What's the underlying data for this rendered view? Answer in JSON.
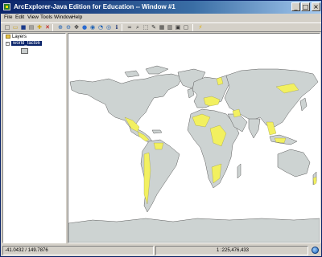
{
  "window": {
    "title": "ArcExplorer-Java Edition for Education -- Window #1",
    "controls": {
      "minimize": "_",
      "maximize": "□",
      "close": "×"
    }
  },
  "menu": [
    "File",
    "Edit",
    "View",
    "Tools",
    "Window",
    "Help"
  ],
  "toolbar": {
    "buttons": [
      {
        "icon": "new-project-icon",
        "glyph": "□"
      },
      {
        "icon": "open-folder-icon",
        "glyph": "▭"
      },
      {
        "icon": "save-icon",
        "glyph": "■"
      },
      {
        "icon": "print-icon",
        "glyph": "▤"
      },
      {
        "icon": "add-layer-icon",
        "glyph": "✚"
      },
      {
        "icon": "remove-layer-icon",
        "glyph": "✕"
      },
      {
        "icon": "zoom-in-icon",
        "glyph": "⊕"
      },
      {
        "icon": "zoom-out-icon",
        "glyph": "⊖"
      },
      {
        "icon": "pan-icon",
        "glyph": "✥"
      },
      {
        "icon": "full-extent-globe-icon",
        "glyph": "●"
      },
      {
        "icon": "zoom-to-layer-icon",
        "glyph": "◉"
      },
      {
        "icon": "zoom-previous-icon",
        "glyph": "◔"
      },
      {
        "icon": "zoom-selected-icon",
        "glyph": "◎"
      },
      {
        "icon": "identify-icon",
        "glyph": "ℹ"
      },
      {
        "icon": "find-binoculars-icon",
        "glyph": "∞"
      },
      {
        "icon": "query-icon",
        "glyph": "⌕"
      },
      {
        "icon": "select-icon",
        "glyph": "⬚"
      },
      {
        "icon": "measure-icon",
        "glyph": "✎"
      },
      {
        "icon": "attribute-table-icon",
        "glyph": "▦"
      },
      {
        "icon": "chart-icon",
        "glyph": "▥"
      },
      {
        "icon": "map-properties-icon",
        "glyph": "▣"
      },
      {
        "icon": "layout-icon",
        "glyph": "▢"
      },
      {
        "icon": "hotlink-lightning-icon",
        "glyph": "⚡"
      }
    ]
  },
  "toc": {
    "root_label": "Layers",
    "layer_label": "world_facts6",
    "expander": "−",
    "swatch_color": "#c8cdcd"
  },
  "map": {
    "land_color": "#cdd3d2",
    "highlight_color": "#f2f060",
    "background": "#ffffff"
  },
  "status": {
    "coordinates": "-41.0432 / 149.7876",
    "scale": "1 :225,476,433"
  }
}
